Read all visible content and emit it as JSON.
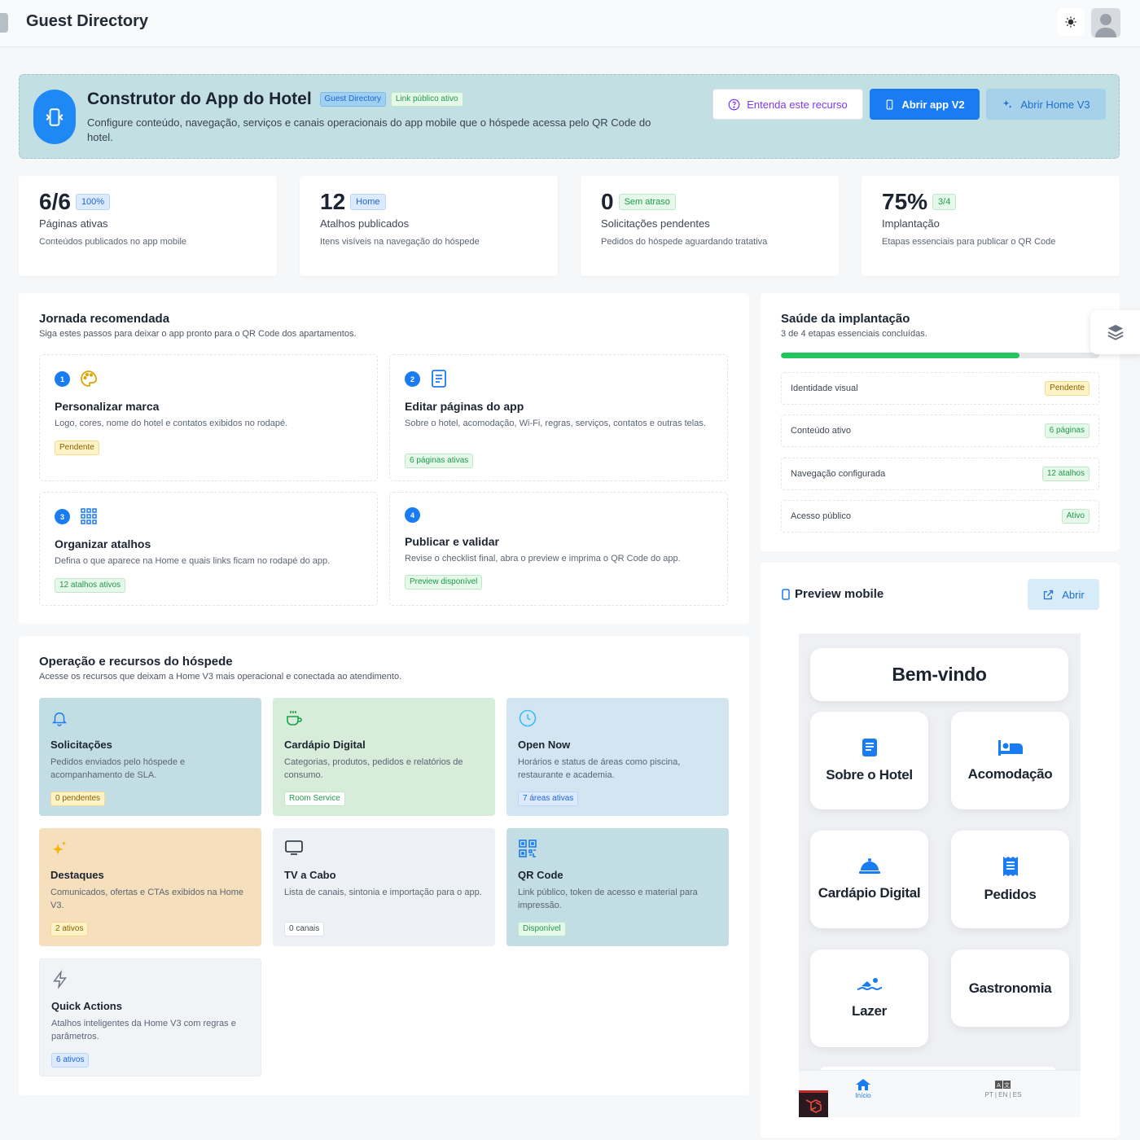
{
  "topbar": {
    "title": "Guest Directory"
  },
  "hero": {
    "title": "Construtor do App do Hotel",
    "badge_directory": "Guest Directory",
    "badge_link": "Link público ativo",
    "description": "Configure conteúdo, navegação, serviços e canais operacionais do app mobile que o hóspede acessa pelo QR Code do hotel.",
    "btn_help": "Entenda este recurso",
    "btn_v2": "Abrir app V2",
    "btn_v3": "Abrir Home V3"
  },
  "stats": [
    {
      "value": "6/6",
      "badge": "100%",
      "label": "Páginas ativas",
      "sub": "Conteúdos publicados no app mobile"
    },
    {
      "value": "12",
      "badge": "Home",
      "label": "Atalhos publicados",
      "sub": "Itens visíveis na navegação do hóspede"
    },
    {
      "value": "0",
      "badge": "Sem atraso",
      "label": "Solicitações pendentes",
      "sub": "Pedidos do hóspede aguardando tratativa"
    },
    {
      "value": "75%",
      "badge": "3/4",
      "label": "Implantação",
      "sub": "Etapas essenciais para publicar o QR Code"
    }
  ],
  "journey": {
    "title": "Jornada recomendada",
    "subtitle": "Siga estes passos para deixar o app pronto para o QR Code dos apartamentos.",
    "steps": [
      {
        "num": "1",
        "title": "Personalizar marca",
        "desc": "Logo, cores, nome do hotel e contatos exibidos no rodapé.",
        "badge": "Pendente"
      },
      {
        "num": "2",
        "title": "Editar páginas do app",
        "desc": "Sobre o hotel, acomodação, Wi-Fi, regras, serviços, contatos e outras telas.",
        "badge": "6 páginas ativas"
      },
      {
        "num": "3",
        "title": "Organizar atalhos",
        "desc": "Defina o que aparece na Home e quais links ficam no rodapé do app.",
        "badge": "12 atalhos ativos"
      },
      {
        "num": "4",
        "title": "Publicar e validar",
        "desc": "Revise o checklist final, abra o preview e imprima o QR Code do app.",
        "badge": "Preview disponível"
      }
    ]
  },
  "health": {
    "title": "Saúde da implantação",
    "subtitle": "3 de 4 etapas essenciais concluídas.",
    "progress": 0.75,
    "rows": [
      {
        "label": "Identidade visual",
        "badge": "Pendente"
      },
      {
        "label": "Conteúdo ativo",
        "badge": "6 páginas"
      },
      {
        "label": "Navegação configurada",
        "badge": "12 atalhos"
      },
      {
        "label": "Acesso público",
        "badge": "Ativo"
      }
    ]
  },
  "operations": {
    "title": "Operação e recursos do hóspede",
    "subtitle": "Acesse os recursos que deixam a Home V3 mais operacional e conectada ao atendimento.",
    "cards": [
      {
        "title": "Solicitações",
        "desc": "Pedidos enviados pelo hóspede e acompanhamento de SLA.",
        "badge": "0 pendentes",
        "icon": "bell-icon",
        "color": "#c3dde4"
      },
      {
        "title": "Cardápio Digital",
        "desc": "Categorias, produtos, pedidos e relatórios de consumo.",
        "badge": "Room Service",
        "icon": "coffee-icon",
        "color": "#d7ecd9"
      },
      {
        "title": "Open Now",
        "desc": "Horários e status de áreas como piscina, restaurante e academia.",
        "badge": "7 áreas ativas",
        "icon": "clock-icon",
        "color": "#d3e5f1"
      },
      {
        "title": "Destaques",
        "desc": "Comunicados, ofertas e CTAs exibidos na Home V3.",
        "badge": "2 ativos",
        "icon": "sparkles-icon",
        "color": "#f6dfbd"
      },
      {
        "title": "TV a Cabo",
        "desc": "Lista de canais, sintonia e importação para o app.",
        "badge": "0 canais",
        "icon": "tv-icon",
        "color": "#edf1f5"
      },
      {
        "title": "QR Code",
        "desc": "Link público, token de acesso e material para impressão.",
        "badge": "Disponível",
        "icon": "qrcode-icon",
        "color": "#c3dde4"
      },
      {
        "title": "Quick Actions",
        "desc": "Atalhos inteligentes da Home V3 com regras e parâmetros.",
        "badge": "6 ativos",
        "icon": "lightning-icon",
        "color": "#f1f4f7"
      }
    ]
  },
  "preview": {
    "title": "Preview mobile",
    "open_label": "Abrir",
    "welcome": "Bem-vindo",
    "tiles": [
      {
        "label": "Sobre o Hotel",
        "icon": "book-icon"
      },
      {
        "label": "Acomodação",
        "icon": "bed-icon"
      },
      {
        "label": "Cardápio Digital",
        "icon": "cloche-icon"
      },
      {
        "label": "Pedidos",
        "icon": "receipt-icon"
      },
      {
        "label": "Lazer",
        "icon": "swim-icon"
      },
      {
        "label": "Gastronomia",
        "icon": ""
      }
    ],
    "nav_home": "Início",
    "nav_lang": "PT | EN | ES"
  },
  "colors": {
    "primary": "#1a7cf2",
    "success": "#22c55e",
    "hero_bg": "#c2dfe4"
  }
}
